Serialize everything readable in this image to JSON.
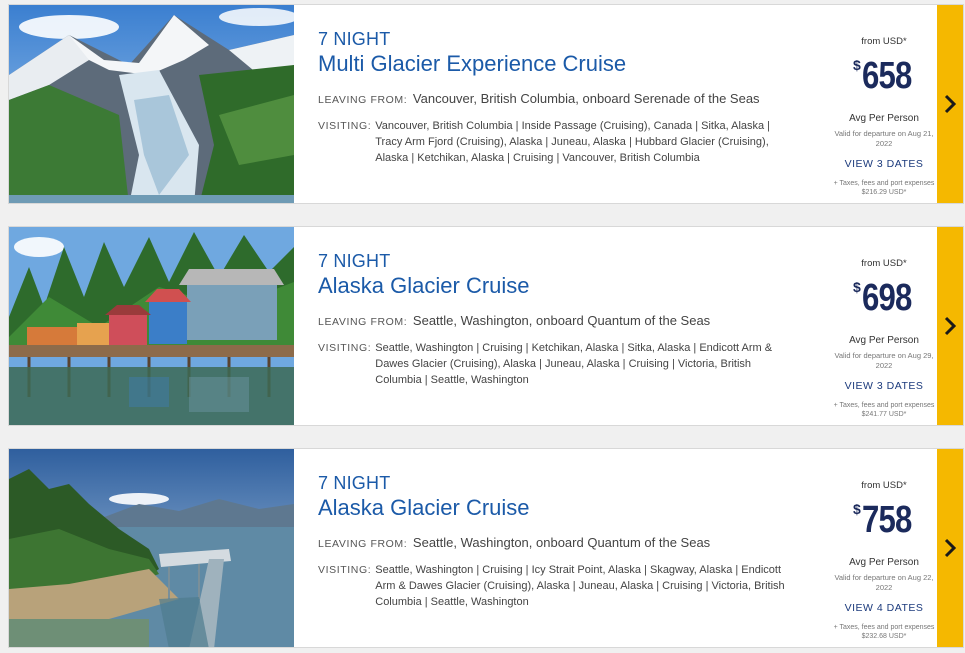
{
  "labels": {
    "leaving": "LEAVING FROM:",
    "visiting": "VISITING:"
  },
  "cruises": [
    {
      "nights": "7 NIGHT",
      "title": "Multi Glacier Experience Cruise",
      "leaving": "Vancouver, British Columbia, onboard Serenade of the Seas",
      "visiting": "Vancouver, British Columbia  |  Inside Passage (Cruising), Canada  |  Sitka, Alaska  |  Tracy Arm Fjord (Cruising), Alaska  |  Juneau, Alaska  |  Hubbard Glacier (Cruising), Alaska  |  Ketchikan, Alaska  |  Cruising  |  Vancouver, British Columbia",
      "from": "from USD*",
      "currency": "$",
      "price": "658",
      "avg": "Avg Per Person",
      "valid": "Valid for departure on Aug 21, 2022",
      "view": "VIEW 3 DATES",
      "taxes": "+ Taxes, fees and port expenses $216.29 USD*",
      "image": "glacier-mountain-photo"
    },
    {
      "nights": "7 NIGHT",
      "title": "Alaska Glacier Cruise",
      "leaving": "Seattle, Washington, onboard Quantum of the Seas",
      "visiting": "Seattle, Washington  |  Cruising  |  Ketchikan, Alaska  |  Sitka, Alaska  |  Endicott Arm & Dawes Glacier (Cruising), Alaska  |  Juneau, Alaska  |  Cruising  |  Victoria, British Columbia  |  Seattle, Washington",
      "from": "from USD*",
      "currency": "$",
      "price": "698",
      "avg": "Avg Per Person",
      "valid": "Valid for departure on Aug 29, 2022",
      "view": "VIEW 3 DATES",
      "taxes": "+ Taxes, fees and port expenses $241.77 USD*",
      "image": "waterfront-houses-photo"
    },
    {
      "nights": "7 NIGHT",
      "title": "Alaska Glacier Cruise",
      "leaving": "Seattle, Washington, onboard Quantum of the Seas",
      "visiting": "Seattle, Washington  |  Cruising  |  Icy Strait Point, Alaska  |  Skagway, Alaska  |  Endicott Arm & Dawes Glacier (Cruising), Alaska  |  Juneau, Alaska  |  Cruising  |  Victoria, British Columbia  |  Seattle, Washington",
      "from": "from USD*",
      "currency": "$",
      "price": "758",
      "avg": "Avg Per Person",
      "valid": "Valid for departure on Aug 22, 2022",
      "view": "VIEW 4 DATES",
      "taxes": "+ Taxes, fees and port expenses $232.68 USD*",
      "image": "coastal-pier-photo"
    }
  ],
  "colors": {
    "title_blue": "#1b5aa8",
    "price_navy": "#1b2a5c",
    "accent_yellow": "#f5b800"
  }
}
